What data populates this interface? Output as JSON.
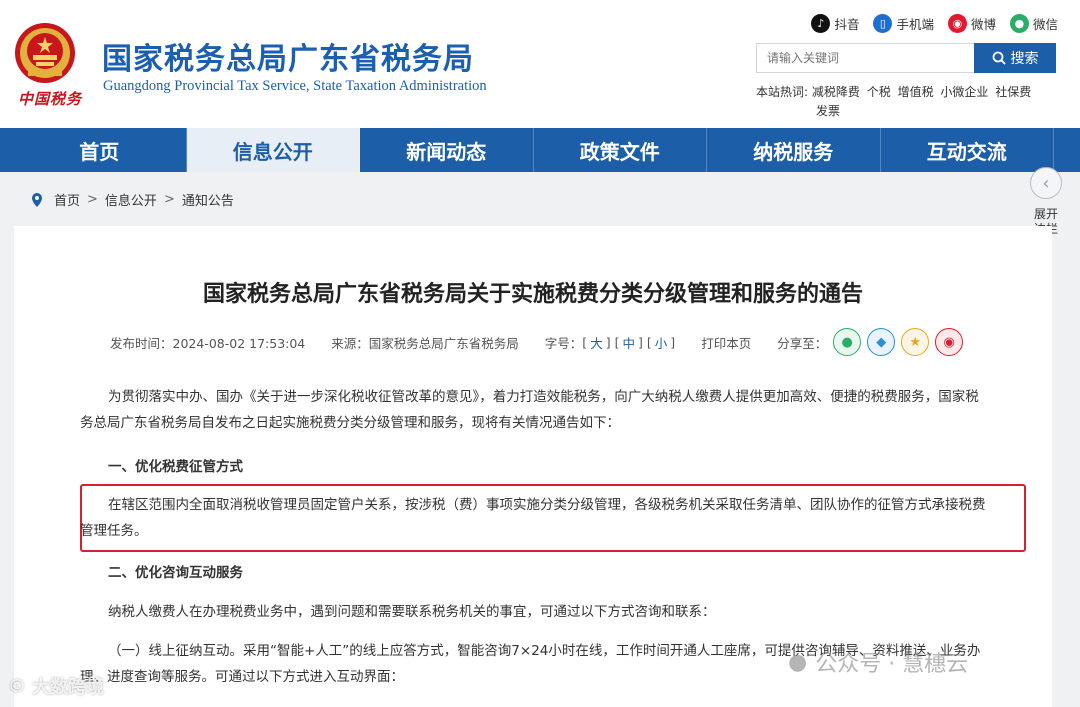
{
  "header": {
    "site_title": "国家税务总局广东省税务局",
    "site_subtitle": "Guangdong Provincial Tax Service, State Taxation Administration",
    "logo_script": "中国税务",
    "social": [
      {
        "label": "抖音",
        "icon": "douyin-icon",
        "color": "#111111"
      },
      {
        "label": "手机端",
        "icon": "mobile-icon",
        "color": "#1d6fd1"
      },
      {
        "label": "微博",
        "icon": "weibo-icon",
        "color": "#e6162d"
      },
      {
        "label": "微信",
        "icon": "wechat-icon",
        "color": "#2aae67"
      }
    ],
    "search": {
      "placeholder": "请输入关键词",
      "button_label": "搜索"
    },
    "hotwords": {
      "prefix": "本站热词:",
      "words": [
        "减税降费",
        "个税",
        "增值税",
        "小微企业",
        "社保费",
        "发票"
      ]
    }
  },
  "nav": {
    "items": [
      {
        "label": "首页",
        "active": false
      },
      {
        "label": "信息公开",
        "active": true
      },
      {
        "label": "新闻动态",
        "active": false
      },
      {
        "label": "政策文件",
        "active": false
      },
      {
        "label": "纳税服务",
        "active": false
      },
      {
        "label": "互动交流",
        "active": false
      }
    ]
  },
  "breadcrumb": [
    "首页",
    "信息公开",
    "通知公告"
  ],
  "side_toggle": {
    "label": "展开边栏"
  },
  "article": {
    "title": "国家税务总局广东省税务局关于实施税费分类分级管理和服务的通告",
    "meta": {
      "publish_time": "发布时间：2024-08-02 17:53:04",
      "source": "来源：国家税务总局广东省税务局",
      "font_size_label": "字号：",
      "size_large": "大",
      "size_medium": "中",
      "size_small": "小",
      "print": "打印本页",
      "share_label": "分享至："
    },
    "para1": "为贯彻落实中办、国办《关于进一步深化税收征管改革的意见》，着力打造效能税务，向广大纳税人缴费人提供更加高效、便捷的税费服务，国家税务总局广东省税务局自发布之日起实施税费分类分级管理和服务，现将有关情况通告如下：",
    "heading1": "一、优化税费征管方式",
    "para2": "在辖区范围内全面取消税收管理员固定管户关系，按涉税（费）事项实施分类分级管理，各级税务机关采取任务清单、团队协作的征管方式承接税费管理任务。",
    "heading2": "二、优化咨询互动服务",
    "para3": "纳税人缴费人在办理税费业务中，遇到问题和需要联系税务机关的事宜，可通过以下方式咨询和联系：",
    "para4": "（一）线上征纳互动。采用“智能+人工”的线上应答方式，智能咨询7×24小时在线，工作时间开通人工座席，可提供咨询辅导、资料推送、业务办理、进度查询等服务。可通过以下方式进入互动界面："
  },
  "watermarks": {
    "left": "大数跨境",
    "right": "公众号 · 慧穗云"
  }
}
